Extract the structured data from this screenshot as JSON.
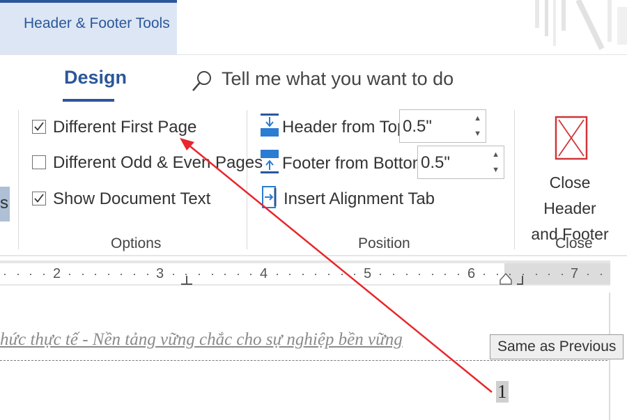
{
  "context_tab": {
    "label": "Header & Footer Tools"
  },
  "tabs": {
    "design": "Design"
  },
  "search": {
    "text": "Tell me what you want to do"
  },
  "options_group": {
    "items": [
      {
        "label": "Different First Page",
        "checked": true
      },
      {
        "label": "Different Odd & Even Pages",
        "checked": false
      },
      {
        "label": "Show Document Text",
        "checked": true
      }
    ],
    "label": "Options"
  },
  "position_group": {
    "header_from_top": {
      "label": "Header from Top:",
      "value": "0.5\""
    },
    "footer_from_bottom": {
      "label": "Footer from Bottom:",
      "value": "0.5\""
    },
    "insert_alignment_tab": "Insert Alignment Tab",
    "label": "Position"
  },
  "close_group": {
    "button_line1": "Close Header",
    "button_line2": "and Footer",
    "label": "Close"
  },
  "left_stub": "s",
  "ruler": {
    "numbers": [
      "2",
      "3",
      "4",
      "5",
      "6",
      "7"
    ]
  },
  "document": {
    "header_text": "hức thực tế - Nền tảng vững chắc cho sự nghiệp bền vững",
    "same_as_previous": "Same as Previous",
    "page_number": "1"
  },
  "colors": {
    "accent": "#2b579a",
    "context_tab_bg": "#dce6f4",
    "close_icon": "#d13438",
    "annotation_arrow": "#e8262b"
  },
  "icons": {
    "search": "search-icon",
    "header_from_top": "header-from-top-icon",
    "footer_from_bottom": "footer-from-bottom-icon",
    "insert_alignment_tab": "alignment-tab-icon",
    "close": "close-icon"
  }
}
